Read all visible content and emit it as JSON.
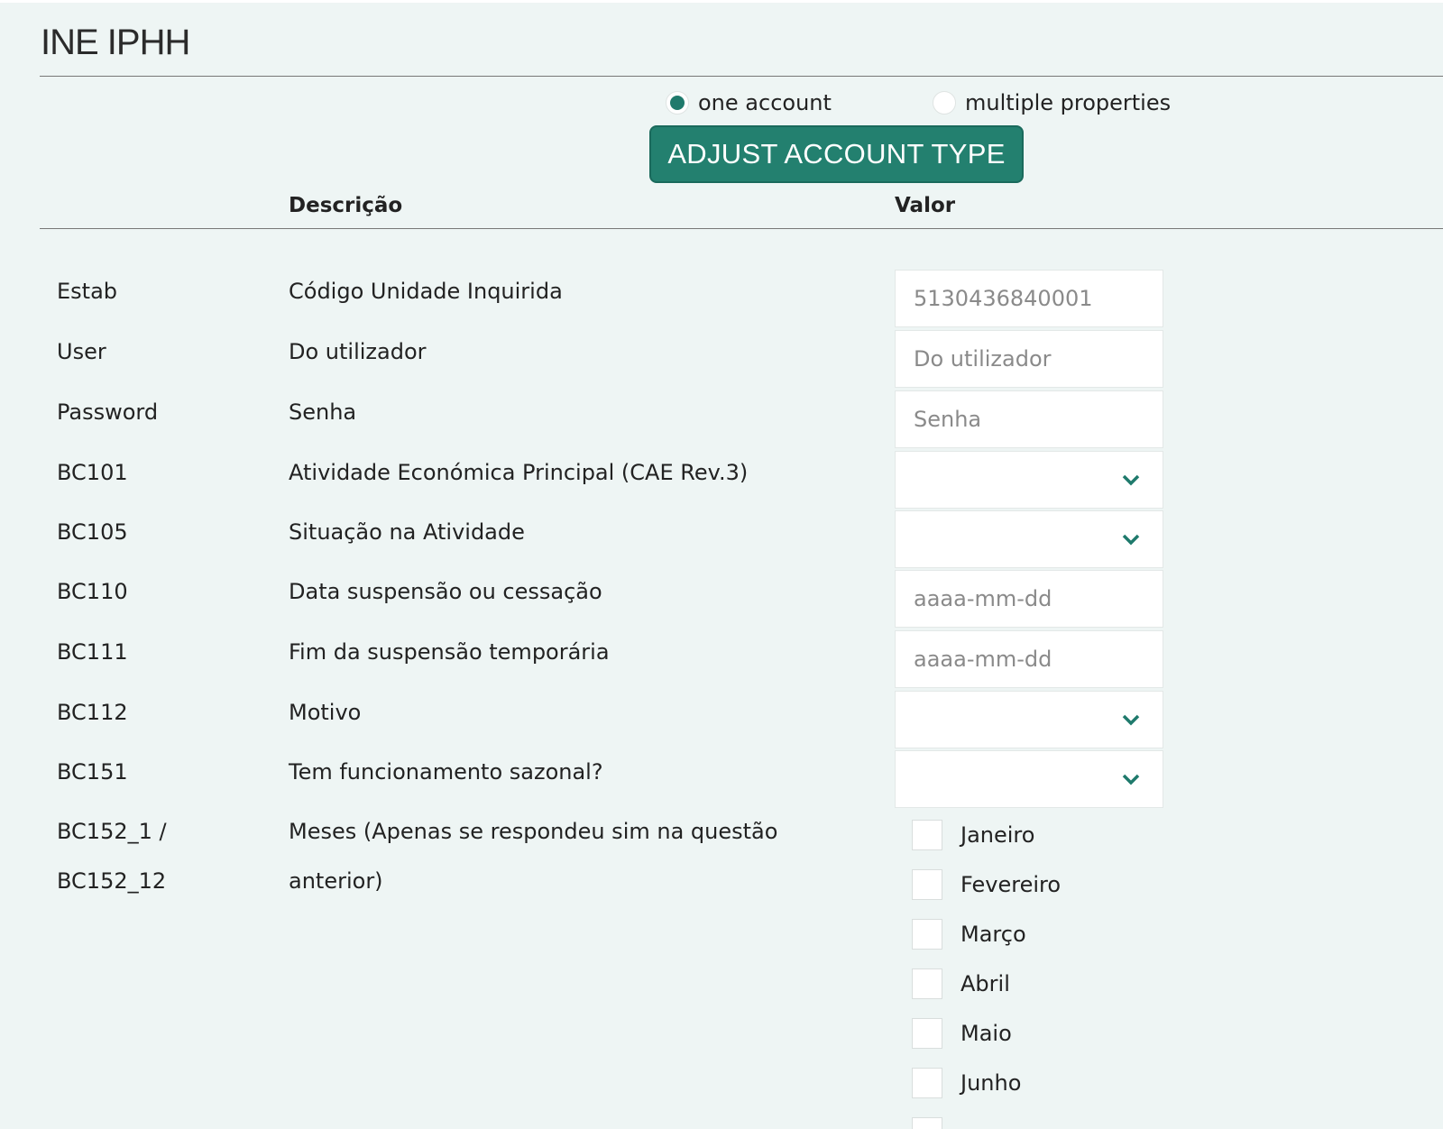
{
  "app": {
    "title": "INE IPHH"
  },
  "account_type": {
    "option_one": "one account",
    "option_multi": "multiple properties",
    "selected": "one account",
    "button_label": "ADJUST ACCOUNT TYPE"
  },
  "table": {
    "header_description": "Descrição",
    "header_value": "Valor"
  },
  "rows": [
    {
      "code": "Estab",
      "description": "Código Unidade Inquirida",
      "value": "5130436840001"
    },
    {
      "code": "User",
      "description": "Do utilizador",
      "placeholder": "Do utilizador"
    },
    {
      "code": "Password",
      "description": "Senha",
      "placeholder": "Senha"
    },
    {
      "code": "BC101",
      "description": "Atividade Económica Principal (CAE Rev.3)",
      "value": ""
    },
    {
      "code": "BC105",
      "description": "Situação na Atividade",
      "value": ""
    },
    {
      "code": "BC110",
      "description": "Data suspensão ou cessação",
      "placeholder": "aaaa-mm-dd"
    },
    {
      "code": "BC111",
      "description": "Fim da suspensão temporária",
      "placeholder": "aaaa-mm-dd"
    },
    {
      "code": "BC112",
      "description": "Motivo",
      "value": ""
    },
    {
      "code": "BC151",
      "description": "Tem funcionamento sazonal?",
      "value": ""
    }
  ],
  "months_row": {
    "code_line1": "BC152_1 /",
    "code_line2": "BC152_12",
    "description_line1": "Meses (Apenas se respondeu sim na questão",
    "description_line2": "anterior)",
    "months": [
      "Janeiro",
      "Fevereiro",
      "Março",
      "Abril",
      "Maio",
      "Junho"
    ]
  },
  "colors": {
    "accent": "#23806f",
    "background": "#eef5f4"
  },
  "icons": {
    "dropdown": "chevron-down-icon"
  }
}
